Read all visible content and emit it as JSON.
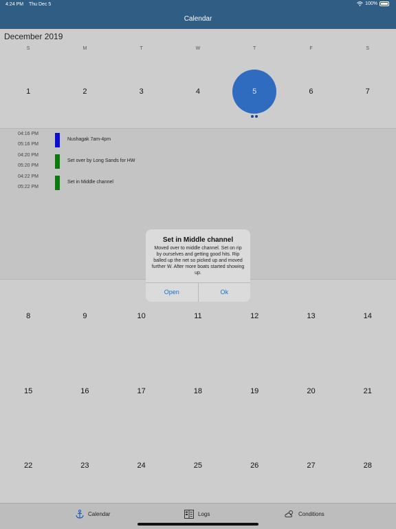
{
  "status_bar": {
    "time": "4:24 PM",
    "date": "Thu Dec 5",
    "battery": "100%"
  },
  "nav": {
    "title": "Calendar"
  },
  "calendar": {
    "month_title": "December 2019",
    "weekdays": [
      "S",
      "M",
      "T",
      "W",
      "T",
      "F",
      "S"
    ],
    "weeks": [
      [
        "1",
        "2",
        "3",
        "4",
        "5",
        "6",
        "7"
      ],
      [
        "8",
        "9",
        "10",
        "11",
        "12",
        "13",
        "14"
      ],
      [
        "15",
        "16",
        "17",
        "18",
        "19",
        "20",
        "21"
      ],
      [
        "22",
        "23",
        "24",
        "25",
        "26",
        "27",
        "28"
      ]
    ],
    "selected_day": "5"
  },
  "events": [
    {
      "start": "04:16 PM",
      "end": "05:16 PM",
      "title": "Nushagak 7am-4pm",
      "color": "#0b0bd6"
    },
    {
      "start": "04:20 PM",
      "end": "05:20 PM",
      "title": "Set over by Long Sands for HW",
      "color": "#0a7a0a"
    },
    {
      "start": "04:22 PM",
      "end": "05:22 PM",
      "title": "Set in Middle channel",
      "color": "#0a7a0a"
    }
  ],
  "dialog": {
    "title": "Set in Middle channel",
    "message": "Moved over to middle channel. Set on rip by ourselves and getting good hits. Rip balled up the net so picked up and moved further W. After more boats started showing up.",
    "open_label": "Open",
    "ok_label": "Ok"
  },
  "tabs": {
    "calendar_label": "Calendar",
    "logs_label": "Logs",
    "conditions_label": "Conditions",
    "calendar_icon": "anchor-icon",
    "logs_icon": "log-book-icon",
    "conditions_icon": "cloud-sun-icon"
  }
}
